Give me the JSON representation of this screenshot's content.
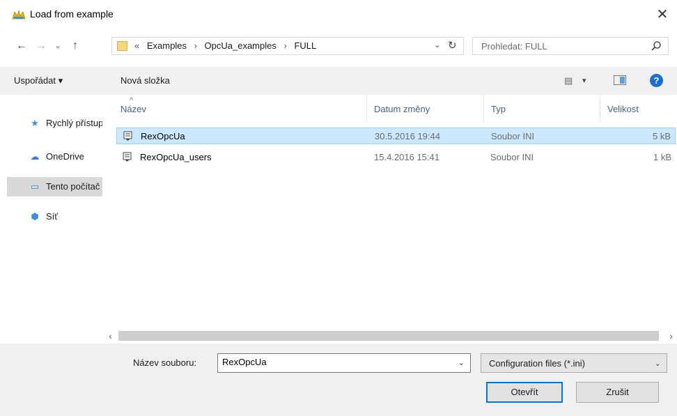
{
  "window": {
    "title": "Load from example",
    "close_glyph": "✕"
  },
  "nav": {
    "back_glyph": "←",
    "forward_glyph": "→",
    "history_glyph": "⌄",
    "up_glyph": "↑",
    "breadcrumb": [
      "«",
      "Examples",
      "›",
      "OpcUa_examples",
      "›",
      "FULL"
    ],
    "address_dropdown_glyph": "⌄",
    "refresh_glyph": "↻",
    "search_placeholder": "Prohledat: FULL"
  },
  "toolbar": {
    "organize_label": "Uspořádat ▾",
    "new_folder_label": "Nová složka",
    "view_glyph": "▤",
    "view_dropdown_glyph": "▾",
    "help_glyph": "?"
  },
  "sidebar": {
    "items": [
      {
        "label": "Rychlý přístup",
        "icon": "star-icon",
        "glyph": "★",
        "color": "#3c8ee0"
      },
      {
        "label": "OneDrive",
        "icon": "cloud-icon",
        "glyph": "☁",
        "color": "#2f7fd8"
      },
      {
        "label": "Tento počítač",
        "icon": "computer-icon",
        "glyph": "▭",
        "color": "#2d8ed8",
        "selected": true
      },
      {
        "label": "Síť",
        "icon": "network-icon",
        "glyph": "⬢",
        "color": "#3c8ee0"
      }
    ]
  },
  "filelist": {
    "sort_glyph": "^",
    "columns": [
      "Název",
      "Datum změny",
      "Typ",
      "Velikost"
    ],
    "rows": [
      {
        "name": "RexOpcUa",
        "date": "30.5.2016 19:44",
        "type": "Soubor INI",
        "size": "5 kB",
        "selected": true
      },
      {
        "name": "RexOpcUa_users",
        "date": "15.4.2016 15:41",
        "type": "Soubor INI",
        "size": "1 kB",
        "selected": false
      }
    ]
  },
  "scrollbar": {
    "left_glyph": "‹",
    "right_glyph": "›"
  },
  "bottom": {
    "filename_label": "Název souboru:",
    "filename_value": "RexOpcUa",
    "filename_dropdown_glyph": "⌄",
    "filter_label": "Configuration files (*.ini)",
    "filter_dropdown_glyph": "⌄",
    "open_label": "Otevřít",
    "cancel_label": "Zrušit"
  },
  "colors": {
    "selection_bg": "#cce8ff",
    "selection_border": "#99d1ff",
    "accent": "#0078d7"
  }
}
